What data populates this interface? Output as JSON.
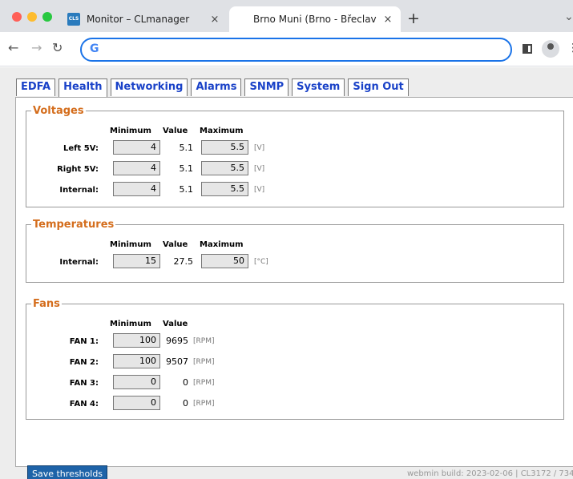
{
  "browser": {
    "tabs": [
      {
        "title": "Monitor – CLmanager",
        "favicon_text": "CLS"
      },
      {
        "title": "Brno Muni (Brno - Břeclav - O"
      }
    ],
    "new_tab": "+",
    "close": "×",
    "omnibox_icon": "G",
    "icons": [
      "back-icon",
      "forward-icon",
      "reload-icon",
      "sidebar-icon",
      "profile-icon",
      "menu-icon"
    ]
  },
  "nav": {
    "tabs": [
      "EDFA",
      "Health",
      "Networking",
      "Alarms",
      "SNMP",
      "System",
      "Sign Out"
    ],
    "active": "Health"
  },
  "voltages": {
    "title": "Voltages",
    "headers": {
      "minimum": "Minimum",
      "value": "Value",
      "maximum": "Maximum"
    },
    "rows": [
      {
        "label": "Left 5V:",
        "min": "4",
        "value": "5.1",
        "max": "5.5",
        "unit": "[V]"
      },
      {
        "label": "Right 5V:",
        "min": "4",
        "value": "5.1",
        "max": "5.5",
        "unit": "[V]"
      },
      {
        "label": "Internal:",
        "min": "4",
        "value": "5.1",
        "max": "5.5",
        "unit": "[V]"
      }
    ]
  },
  "temperatures": {
    "title": "Temperatures",
    "headers": {
      "minimum": "Minimum",
      "value": "Value",
      "maximum": "Maximum"
    },
    "rows": [
      {
        "label": "Internal:",
        "min": "15",
        "value": "27.5",
        "max": "50",
        "unit": "[°C]"
      }
    ]
  },
  "fans": {
    "title": "Fans",
    "headers": {
      "minimum": "Minimum",
      "value": "Value"
    },
    "rows": [
      {
        "label": "FAN 1:",
        "min": "100",
        "value": "9695",
        "unit": "[RPM]"
      },
      {
        "label": "FAN 2:",
        "min": "100",
        "value": "9507",
        "unit": "[RPM]"
      },
      {
        "label": "FAN 3:",
        "min": "0",
        "value": "0",
        "unit": "[RPM]"
      },
      {
        "label": "FAN 4:",
        "min": "0",
        "value": "0",
        "unit": "[RPM]"
      }
    ]
  },
  "save_label": "Save thresholds",
  "footer": "webmin build: 2023-02-06 | CL3172 / 734"
}
